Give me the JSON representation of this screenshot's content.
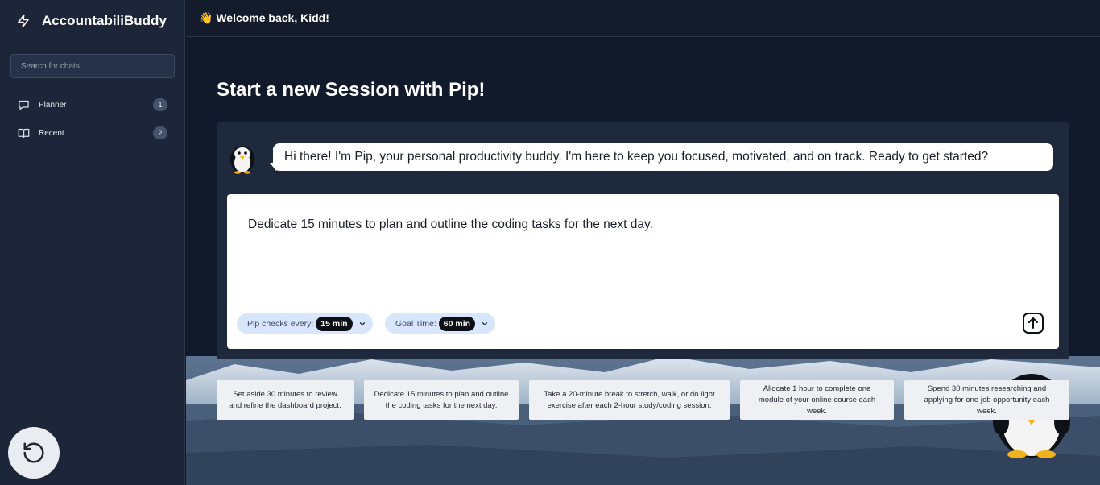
{
  "sidebar": {
    "brand": "AccountabiliBuddy",
    "search_placeholder": "Search for chats...",
    "items": [
      {
        "label": "Planner",
        "badge": "1",
        "icon": "chat-bubble-icon"
      },
      {
        "label": "Recent",
        "badge": "2",
        "icon": "book-icon"
      }
    ],
    "restore_icon": "restore-icon"
  },
  "header": {
    "welcome": "👋 Welcome back, Kidd!"
  },
  "main": {
    "headline": "Start a new Session with Pip!",
    "pip_message": "Hi there! I'm Pip, your personal productivity buddy. I'm here to keep you focused, motivated, and on track. Ready to get started?",
    "input_text": "Dedicate 15 minutes to plan and outline the coding tasks for the next day.",
    "check_label": "Pip checks every:",
    "check_value": "15 min",
    "goal_label": "Goal Time:",
    "goal_value": "60 min",
    "send_icon": "upload-arrow-icon"
  },
  "suggestions": [
    "Set aside 30 minutes to review and refine the dashboard project.",
    "Dedicate 15 minutes to plan and outline the coding tasks for the next day.",
    "Take a 20-minute break to stretch, walk, or do light exercise after each 2-hour study/coding session.",
    "Allocate 1 hour to complete one module of your online course each week.",
    "Spend 30 minutes researching and applying for one job opportunity each week."
  ],
  "colors": {
    "sidebar_bg": "#1c2638",
    "main_bg": "#111a2a",
    "card_bg": "#1e2a3c",
    "chip_bg": "#d7e6fb",
    "chip_value_bg": "#0c0f14"
  }
}
